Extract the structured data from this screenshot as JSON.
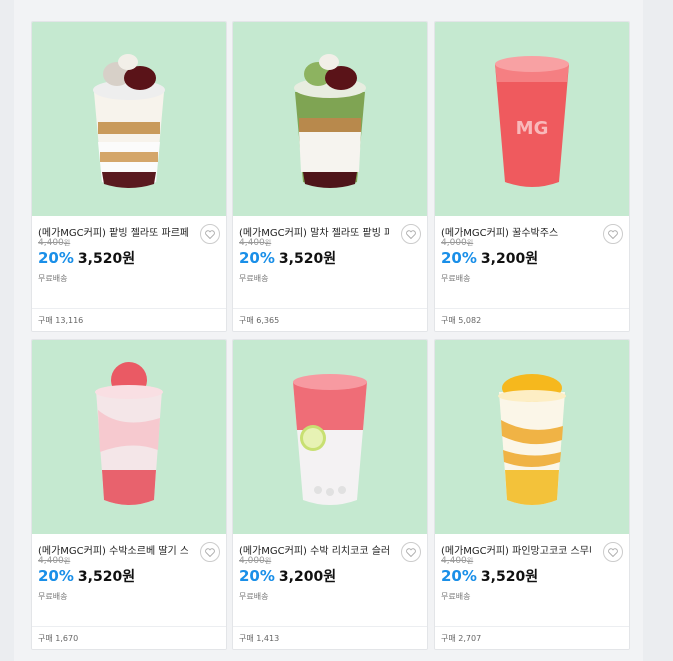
{
  "colors": {
    "accent_blue": "#1a8fe8",
    "image_bg": "#c5e9d0"
  },
  "icons": {
    "wishlist": "heart-icon"
  },
  "products": [
    {
      "title": "(메가MGC커피) 팥빙 젤라또 파르페",
      "original_price": "4,400",
      "currency": "원",
      "discount_rate": "20%",
      "price": "3,520원",
      "shipping": "무료배송",
      "sales": "구매 13,116"
    },
    {
      "title": "(메가MGC커피) 말차 젤라또 팥빙 파르페",
      "original_price": "4,400",
      "currency": "원",
      "discount_rate": "20%",
      "price": "3,520원",
      "shipping": "무료배송",
      "sales": "구매 6,365"
    },
    {
      "title": "(메가MGC커피) 꿀수박주스",
      "original_price": "4,000",
      "currency": "원",
      "discount_rate": "20%",
      "price": "3,200원",
      "shipping": "무료배송",
      "sales": "구매 5,082"
    },
    {
      "title": "(메가MGC커피) 수박소르베 딸기 스무디",
      "original_price": "4,400",
      "currency": "원",
      "discount_rate": "20%",
      "price": "3,520원",
      "shipping": "무료배송",
      "sales": "구매 1,670"
    },
    {
      "title": "(메가MGC커피) 수박 리치코코 슬러시",
      "original_price": "4,000",
      "currency": "원",
      "discount_rate": "20%",
      "price": "3,200원",
      "shipping": "무료배송",
      "sales": "구매 1,413"
    },
    {
      "title": "(메가MGC커피) 파인망고코코 스무디",
      "original_price": "4,400",
      "currency": "원",
      "discount_rate": "20%",
      "price": "3,520원",
      "shipping": "무료배송",
      "sales": "구매 2,707"
    }
  ]
}
